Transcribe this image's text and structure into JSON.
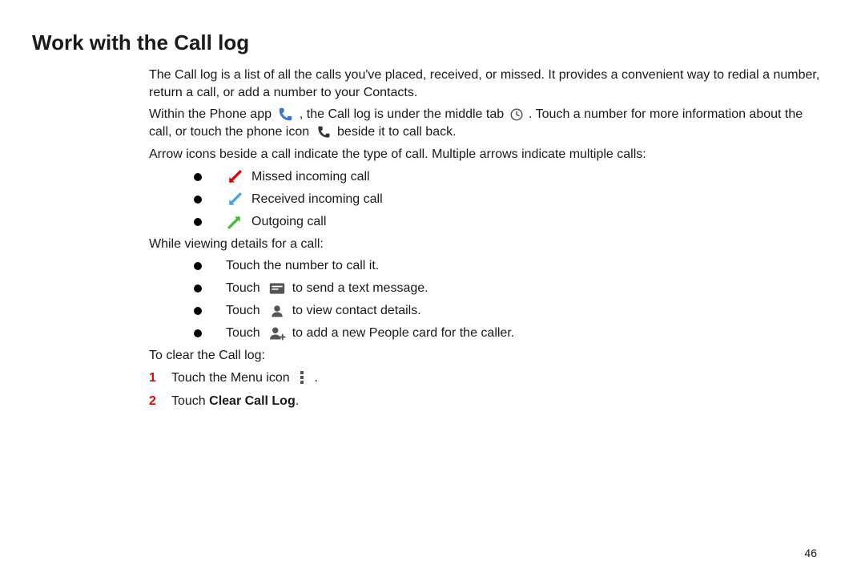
{
  "heading": "Work with the Call log",
  "intro_p1": "The Call log is a list of all the calls you've placed, received, or missed. It provides a convenient way to redial a number, return a call, or add a number to your Contacts.",
  "inline_p2_a": "Within the Phone app ",
  "inline_p2_b": " , the Call log is under the middle tab ",
  "inline_p2_c": " . Touch a number for more information about the call, or touch the phone icon ",
  "inline_p2_d": "  beside it to call back.",
  "intro_p3": "Arrow icons beside a call indicate the type of call. Multiple arrows indicate multiple calls:",
  "call_types": [
    {
      "label": "Missed incoming call",
      "color": "#e60000",
      "dir": "down-left"
    },
    {
      "label": "Received incoming call",
      "color": "#3aa9e6",
      "dir": "down-left"
    },
    {
      "label": "Outgoing call",
      "color": "#3fbf2f",
      "dir": "up-right"
    }
  ],
  "details_lead": "While viewing details for a call:",
  "details_items": {
    "it1": "Touch the number to call it.",
    "it2_a": "Touch ",
    "it2_b": " to send a text message.",
    "it3_a": "Touch ",
    "it3_b": " to view contact details.",
    "it4_a": "Touch ",
    "it4_b": " to add a new People card for the caller."
  },
  "clear_lead": "To clear the Call log:",
  "steps": {
    "s1_num": "1",
    "s1_a": "Touch the Menu icon ",
    "s1_b": " .",
    "s2_num": "2",
    "s2_a": "Touch ",
    "s2_bold": "Clear Call Log",
    "s2_b": "."
  },
  "page_number": "46"
}
